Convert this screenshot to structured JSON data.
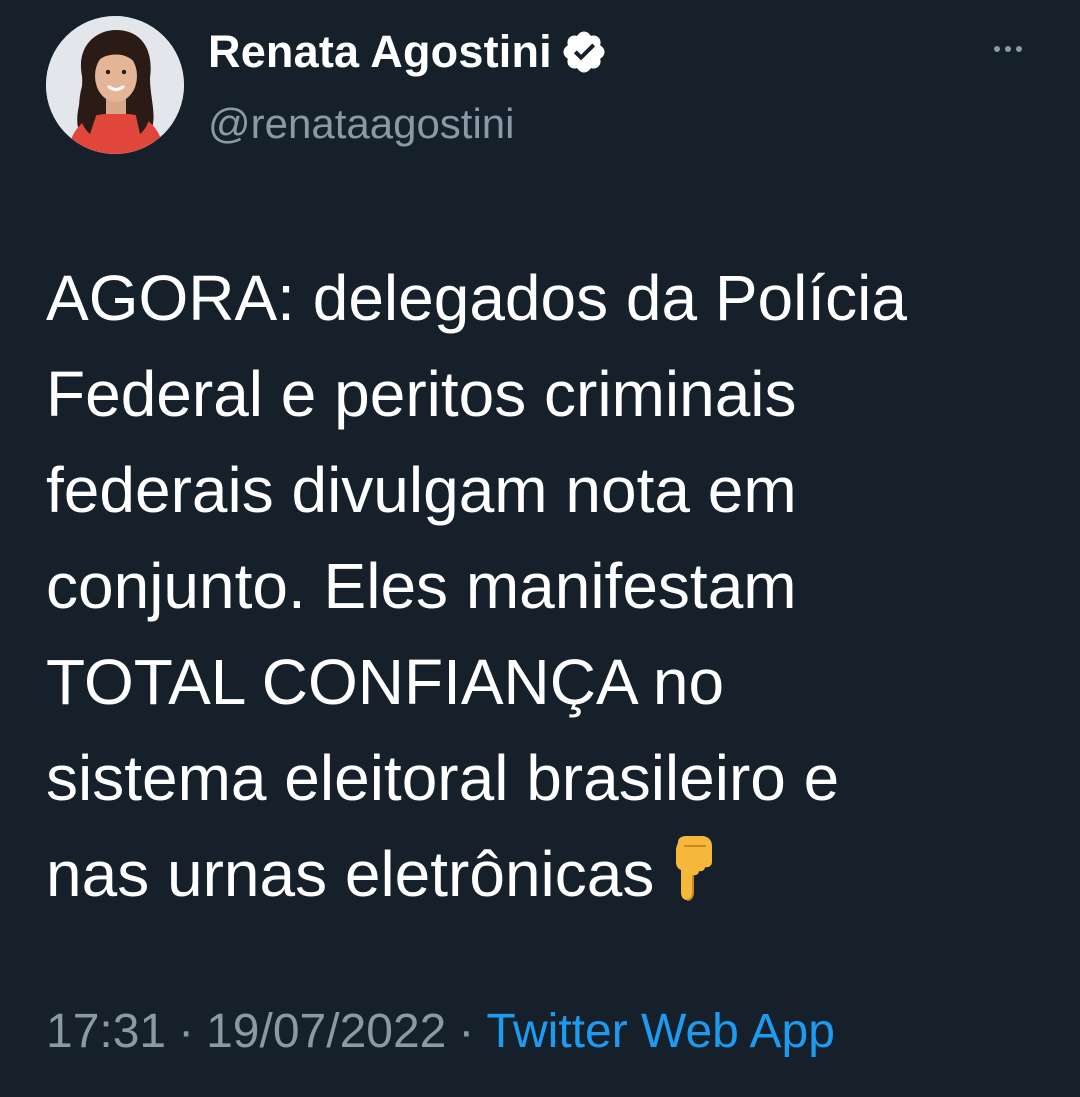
{
  "author": {
    "display_name": "Renata Agostini",
    "handle": "@renataagostini",
    "verified": true,
    "avatar_icon": "profile-photo"
  },
  "tweet": {
    "lines": [
      "AGORA: delegados da Polícia",
      "Federal e peritos criminais",
      "federais divulgam nota em",
      "conjunto. Eles manifestam",
      "TOTAL CONFIANÇA no",
      "sistema eleitoral brasileiro e",
      "nas urnas eletrônicas"
    ],
    "emoji": "👇",
    "emoji_name": "backhand-index-pointing-down-icon"
  },
  "meta": {
    "time": "17:31",
    "date": "19/07/2022",
    "separator": "·",
    "source": "Twitter Web App"
  },
  "colors": {
    "background": "#15202b",
    "text": "#ffffff",
    "secondary_text": "#8b98a5",
    "link": "#1d9bf0"
  }
}
